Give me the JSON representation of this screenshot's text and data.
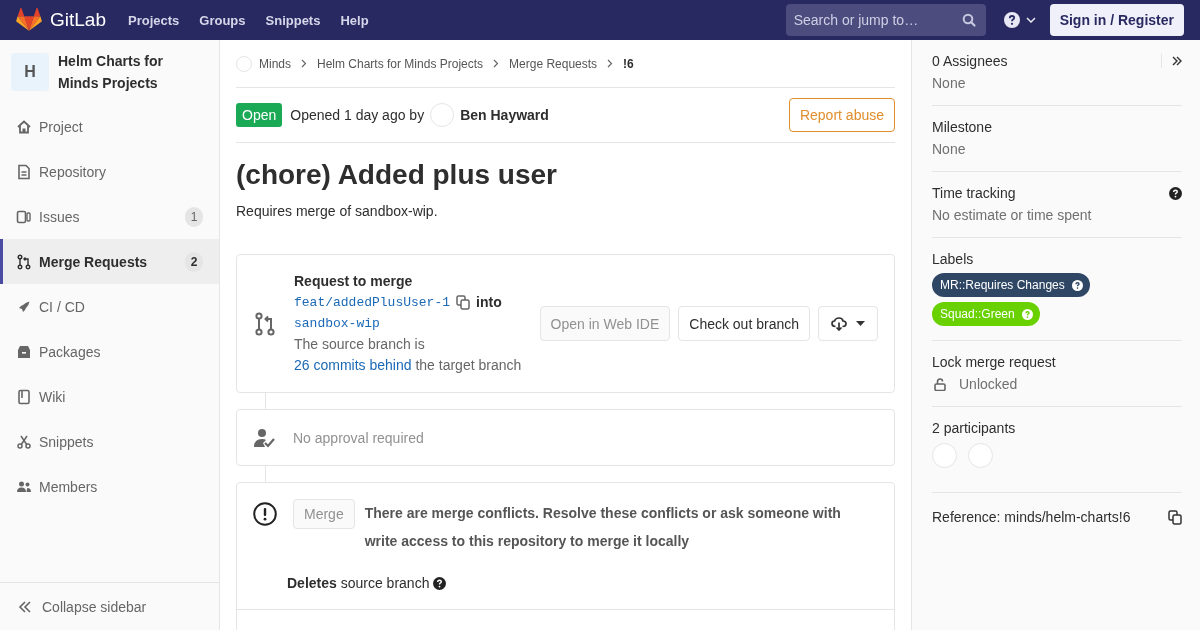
{
  "navbar": {
    "brand": "GitLab",
    "links": [
      "Projects",
      "Groups",
      "Snippets",
      "Help"
    ],
    "search": {
      "placeholder": "Search or jump to…"
    },
    "sign_in": "Sign in / Register"
  },
  "sidebar": {
    "avatar": "H",
    "project": "Helm Charts for Minds Projects",
    "items": [
      {
        "label": "Project",
        "selected": false
      },
      {
        "label": "Repository",
        "selected": false
      },
      {
        "label": "Issues",
        "count": "1",
        "selected": false
      },
      {
        "label": "Merge Requests",
        "count": "2",
        "selected": true
      },
      {
        "label": "CI / CD",
        "selected": false
      },
      {
        "label": "Packages",
        "selected": false
      },
      {
        "label": "Wiki",
        "selected": false
      },
      {
        "label": "Snippets",
        "selected": false
      },
      {
        "label": "Members",
        "selected": false
      }
    ],
    "collapse": "Collapse sidebar"
  },
  "breadcrumbs": [
    "Minds",
    "Helm Charts for Minds Projects",
    "Merge Requests",
    "!6"
  ],
  "header": {
    "status": "Open",
    "opened": "Opened 1 day ago by",
    "author": "Ben Hayward",
    "report": "Report abuse"
  },
  "title": "(chore) Added plus user",
  "description": "Requires merge of sandbox-wip.",
  "merge_widget": {
    "heading": "Request to merge",
    "source": "feat/addedPlusUser-1",
    "into": "into",
    "target": "sandbox-wip",
    "status_before": "The source branch is",
    "status_link": "26 commits behind",
    "status_after": "the target branch",
    "buttons": [
      {
        "label": "Open in Web IDE",
        "disabled": true
      },
      {
        "label": "Check out branch",
        "disabled": false
      }
    ]
  },
  "approval": "No approval required",
  "conflicts": {
    "button": {
      "label": "Merge",
      "disabled": true
    },
    "message": "There are merge conflicts. Resolve these conflicts or ask someone with write access to this repository to merge it locally",
    "deletes": "**Deletes** source branch"
  },
  "right_sidebar": {
    "assignees": {
      "title": "0 Assignees",
      "value": "None"
    },
    "milestone": {
      "title": "Milestone",
      "value": "None"
    },
    "time_tracking": {
      "title": "Time tracking",
      "value": "No estimate or time spent"
    },
    "labels": {
      "title": "Labels",
      "items": [
        {
          "text": "MR::Requires Changes",
          "color": "#2f4765"
        },
        {
          "text": "Squad::Green",
          "color": "#69d100"
        }
      ]
    },
    "lock": {
      "title": "Lock merge request",
      "value": "Unlocked"
    },
    "participants": {
      "title": "2 participants",
      "avatars": [
        {
          "kind": "avatar"
        },
        {
          "kind": "avatar"
        }
      ]
    },
    "reference": "Reference: minds/helm-charts!6"
  }
}
